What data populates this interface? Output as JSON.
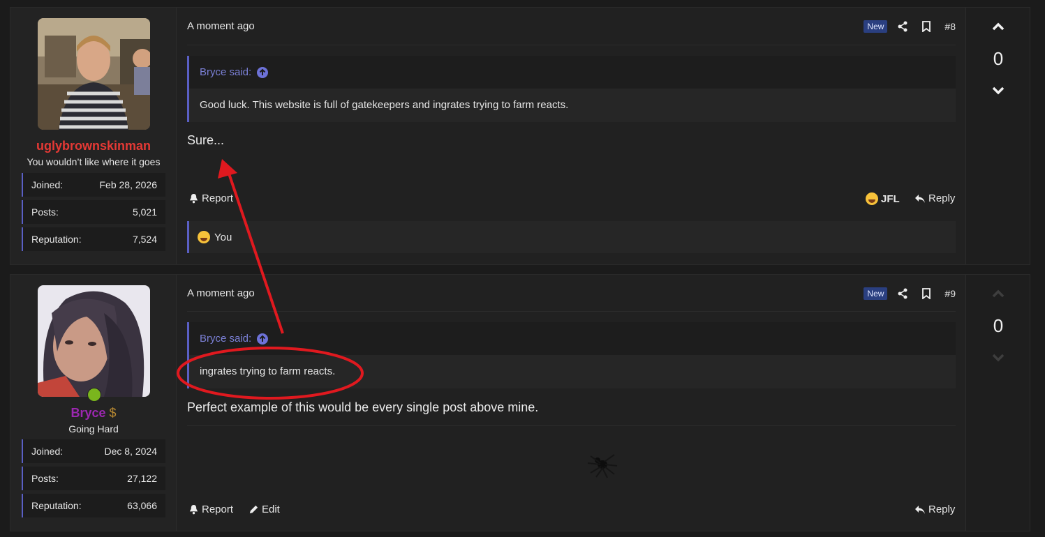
{
  "posts": [
    {
      "user": {
        "name": "uglybrownskinman",
        "name_color": "#e53935",
        "title": "You wouldn’t like where it goes",
        "stats": [
          {
            "label": "Joined:",
            "value": "Feb 28, 2026"
          },
          {
            "label": "Posts:",
            "value": "5,021"
          },
          {
            "label": "Reputation:",
            "value": "7,524"
          }
        ]
      },
      "time": "A moment ago",
      "badge": "New",
      "post_number": "#8",
      "quote": {
        "author": "Bryce said:",
        "text": "Good luck. This website is full of gatekeepers and ingrates trying to farm reacts."
      },
      "message": "Sure...",
      "actions": {
        "report": "Report",
        "react": "JFL",
        "reply": "Reply"
      },
      "reactions": {
        "label": "You"
      },
      "score": "0"
    },
    {
      "user": {
        "name": "Bryce",
        "name_color": "#9c27b0",
        "title": "Going Hard",
        "stats": [
          {
            "label": "Joined:",
            "value": "Dec 8, 2024"
          },
          {
            "label": "Posts:",
            "value": "27,122"
          },
          {
            "label": "Reputation:",
            "value": "63,066"
          }
        ]
      },
      "time": "A moment ago",
      "badge": "New",
      "post_number": "#9",
      "quote": {
        "author": "Bryce said:",
        "text": "ingrates trying to farm reacts."
      },
      "message": "Perfect example of this would be every single post above mine.",
      "actions": {
        "report": "Report",
        "edit": "Edit",
        "reply": "Reply"
      },
      "score": "0"
    }
  ],
  "colors": {
    "accent": "#5a5fc4",
    "annotation": "#e0191f",
    "badge_bg": "#2a3f80"
  }
}
